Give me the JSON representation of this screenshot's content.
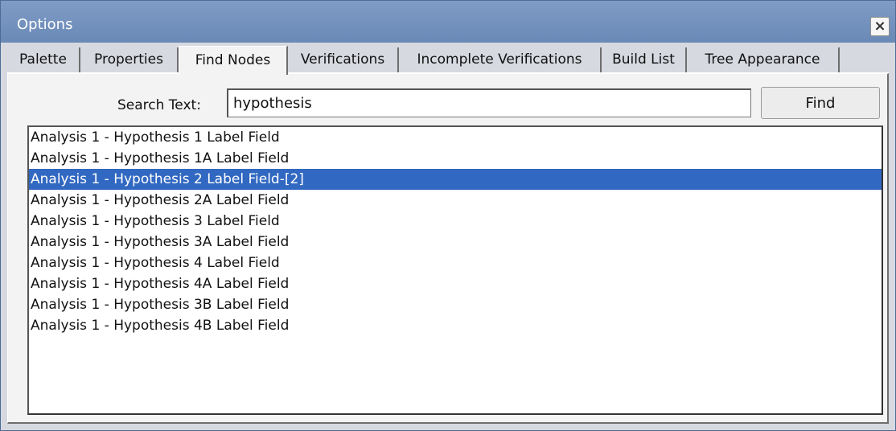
{
  "window": {
    "title": "Options",
    "close_glyph": "×"
  },
  "tabs": [
    {
      "label": "Palette",
      "active": false
    },
    {
      "label": "Properties",
      "active": false
    },
    {
      "label": "Find Nodes",
      "active": true
    },
    {
      "label": "Verifications",
      "active": false
    },
    {
      "label": "Incomplete Verifications",
      "active": false
    },
    {
      "label": "Build List",
      "active": false
    },
    {
      "label": "Tree Appearance",
      "active": false
    }
  ],
  "search": {
    "label": "Search Text:",
    "value": "hypothesis",
    "button_label": "Find"
  },
  "results": {
    "selected_index": 2,
    "items": [
      "Analysis 1 - Hypothesis 1 Label Field",
      "Analysis 1 - Hypothesis 1A Label Field",
      "Analysis 1 - Hypothesis 2 Label Field-[2]",
      "Analysis 1 - Hypothesis 2A Label Field",
      "Analysis 1 - Hypothesis 3 Label Field",
      "Analysis 1 - Hypothesis 3A Label Field",
      "Analysis 1 - Hypothesis 4 Label Field",
      "Analysis 1 - Hypothesis 4A Label Field",
      "Analysis 1 - Hypothesis 3B Label Field",
      "Analysis 1 - Hypothesis 4B Label Field"
    ]
  },
  "colors": {
    "titlebar": "#7393c0",
    "selection": "#3168c1"
  }
}
